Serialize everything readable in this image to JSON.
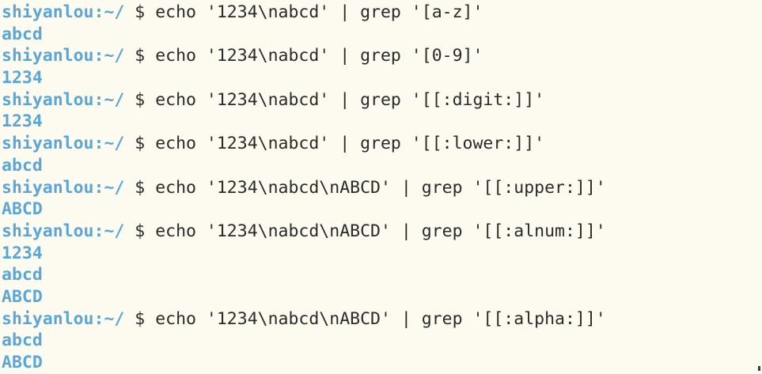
{
  "terminal": {
    "prompt": {
      "user": "shiyanlou",
      "separator": ":",
      "dir": "~/",
      "symbol": "$"
    },
    "lines": [
      {
        "type": "cmd",
        "text": "echo '1234\\nabcd' | grep '[a-z]'"
      },
      {
        "type": "out",
        "text": "abcd"
      },
      {
        "type": "cmd",
        "text": "echo '1234\\nabcd' | grep '[0-9]'"
      },
      {
        "type": "out",
        "text": "1234"
      },
      {
        "type": "cmd",
        "text": "echo '1234\\nabcd' | grep '[[:digit:]]'"
      },
      {
        "type": "out",
        "text": "1234"
      },
      {
        "type": "cmd",
        "text": "echo '1234\\nabcd' | grep '[[:lower:]]'"
      },
      {
        "type": "out",
        "text": "abcd"
      },
      {
        "type": "cmd",
        "text": "echo '1234\\nabcd\\nABCD' | grep '[[:upper:]]'"
      },
      {
        "type": "out",
        "text": "ABCD"
      },
      {
        "type": "cmd",
        "text": "echo '1234\\nabcd\\nABCD' | grep '[[:alnum:]]'"
      },
      {
        "type": "out",
        "text": "1234"
      },
      {
        "type": "out",
        "text": "abcd"
      },
      {
        "type": "out",
        "text": "ABCD"
      },
      {
        "type": "cmd",
        "text": "echo '1234\\nabcd\\nABCD' | grep '[[:alpha:]]'"
      },
      {
        "type": "out",
        "text": "abcd"
      },
      {
        "type": "out",
        "text": "ABCD"
      }
    ]
  },
  "colors": {
    "background": "#fdfaf0",
    "prompt": "#5aa6d6",
    "output": "#5aa6d6",
    "command": "#2a2a2a"
  }
}
